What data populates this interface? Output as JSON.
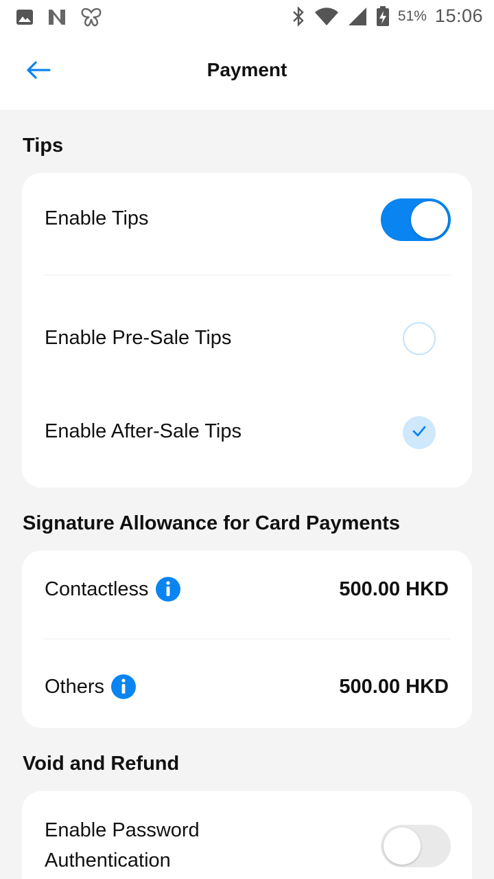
{
  "status_bar": {
    "battery_pct": "51%",
    "time": "15:06",
    "icons": [
      "gallery-icon",
      "n-app-icon",
      "butterfly-icon",
      "bluetooth-icon",
      "wifi-icon",
      "signal-icon",
      "battery-charging-icon"
    ]
  },
  "header": {
    "title": "Payment",
    "back_icon": "arrow-left-icon"
  },
  "tips": {
    "section_title": "Tips",
    "enable_tips_label": "Enable Tips",
    "enable_tips_on": true,
    "pre_sale_label": "Enable Pre-Sale Tips",
    "pre_sale_checked": false,
    "after_sale_label": "Enable After-Sale Tips",
    "after_sale_checked": true
  },
  "signature": {
    "section_title": "Signature Allowance for Card Payments",
    "contactless_label": "Contactless",
    "contactless_value": "500.00 HKD",
    "others_label": "Others",
    "others_value": "500.00 HKD"
  },
  "void_refund": {
    "section_title": "Void and Refund",
    "password_label_line1": "Enable Password",
    "password_label_line2": "Authentication",
    "password_on": false
  },
  "colors": {
    "accent": "#0a84f0",
    "background": "#f4f4f4",
    "card": "#ffffff"
  }
}
